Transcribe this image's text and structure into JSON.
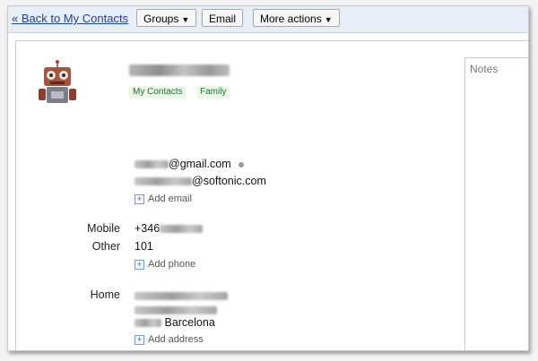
{
  "toolbar": {
    "back_link": "« Back to My Contacts",
    "groups": "Groups",
    "email": "Email",
    "more_actions": "More actions"
  },
  "contact": {
    "groups": [
      "My Contacts",
      "Family"
    ],
    "emails": [
      "@gmail.com",
      "@softonic.com"
    ],
    "add_email": "Add email",
    "phones": [
      {
        "label": "Mobile",
        "value": "+346"
      },
      {
        "label": "Other",
        "value": "101"
      }
    ],
    "add_phone": "Add phone",
    "address": {
      "label": "Home",
      "city": "Barcelona"
    },
    "add_address": "Add address"
  },
  "notes": {
    "label": "Notes"
  },
  "colors": {
    "link": "#1c3fa6",
    "tag_text": "#137a2b",
    "tag_bg": "#eef6ea",
    "topbar": "#e8eef7"
  }
}
